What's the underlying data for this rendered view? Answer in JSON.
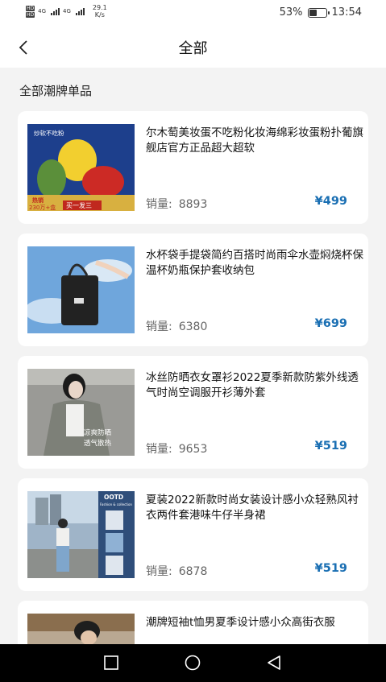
{
  "status": {
    "hd1": "HD",
    "hd2": "HD",
    "net1": "4G",
    "net2": "4G",
    "speed_value": "29.1",
    "speed_unit": "K/s",
    "battery_pct": "53%",
    "battery_level": 0.53,
    "time": "13:54"
  },
  "nav": {
    "title": "全部",
    "back_icon": "chevron-left-icon"
  },
  "section": {
    "title": "全部潮牌单品"
  },
  "products": [
    {
      "title": "尔木萄美妆蛋不吃粉化妆海绵彩妆蛋粉扑葡旗舰店官方正品超大超软",
      "sales_label": "销量:",
      "sales": "8893",
      "price": "¥499",
      "image": {
        "caption_top": "炒软不吃粉",
        "tag_hot": "热销",
        "tag_count": "230万+盒",
        "tag_offer": "买一发三"
      }
    },
    {
      "title": "水杯袋手提袋简约百搭时尚雨伞水壶焖烧杯保温杯奶瓶保护套收纳包",
      "sales_label": "销量:",
      "sales": "6380",
      "price": "¥699"
    },
    {
      "title": "冰丝防晒衣女罩衫2022夏季新款防紫外线透气时尚空调服开衫薄外套",
      "sales_label": "销量:",
      "sales": "9653",
      "price": "¥519",
      "image": {
        "caption_line1": "凉爽防晒",
        "caption_line2": "透气散热"
      }
    },
    {
      "title": "夏装2022新款时尚女装设计感小众轻熟风衬衣两件套港味牛仔半身裙",
      "sales_label": "销量:",
      "sales": "6878",
      "price": "¥519",
      "image": {
        "brand": "OOTD",
        "subtitle": "Fashion & collection"
      }
    },
    {
      "title": "潮牌短袖t恤男夏季设计感小众高街衣服",
      "sales_label": "",
      "sales": "",
      "price": ""
    }
  ],
  "system_nav": {
    "recents_icon": "square-icon",
    "home_icon": "circle-icon",
    "back_icon": "triangle-back-icon"
  }
}
